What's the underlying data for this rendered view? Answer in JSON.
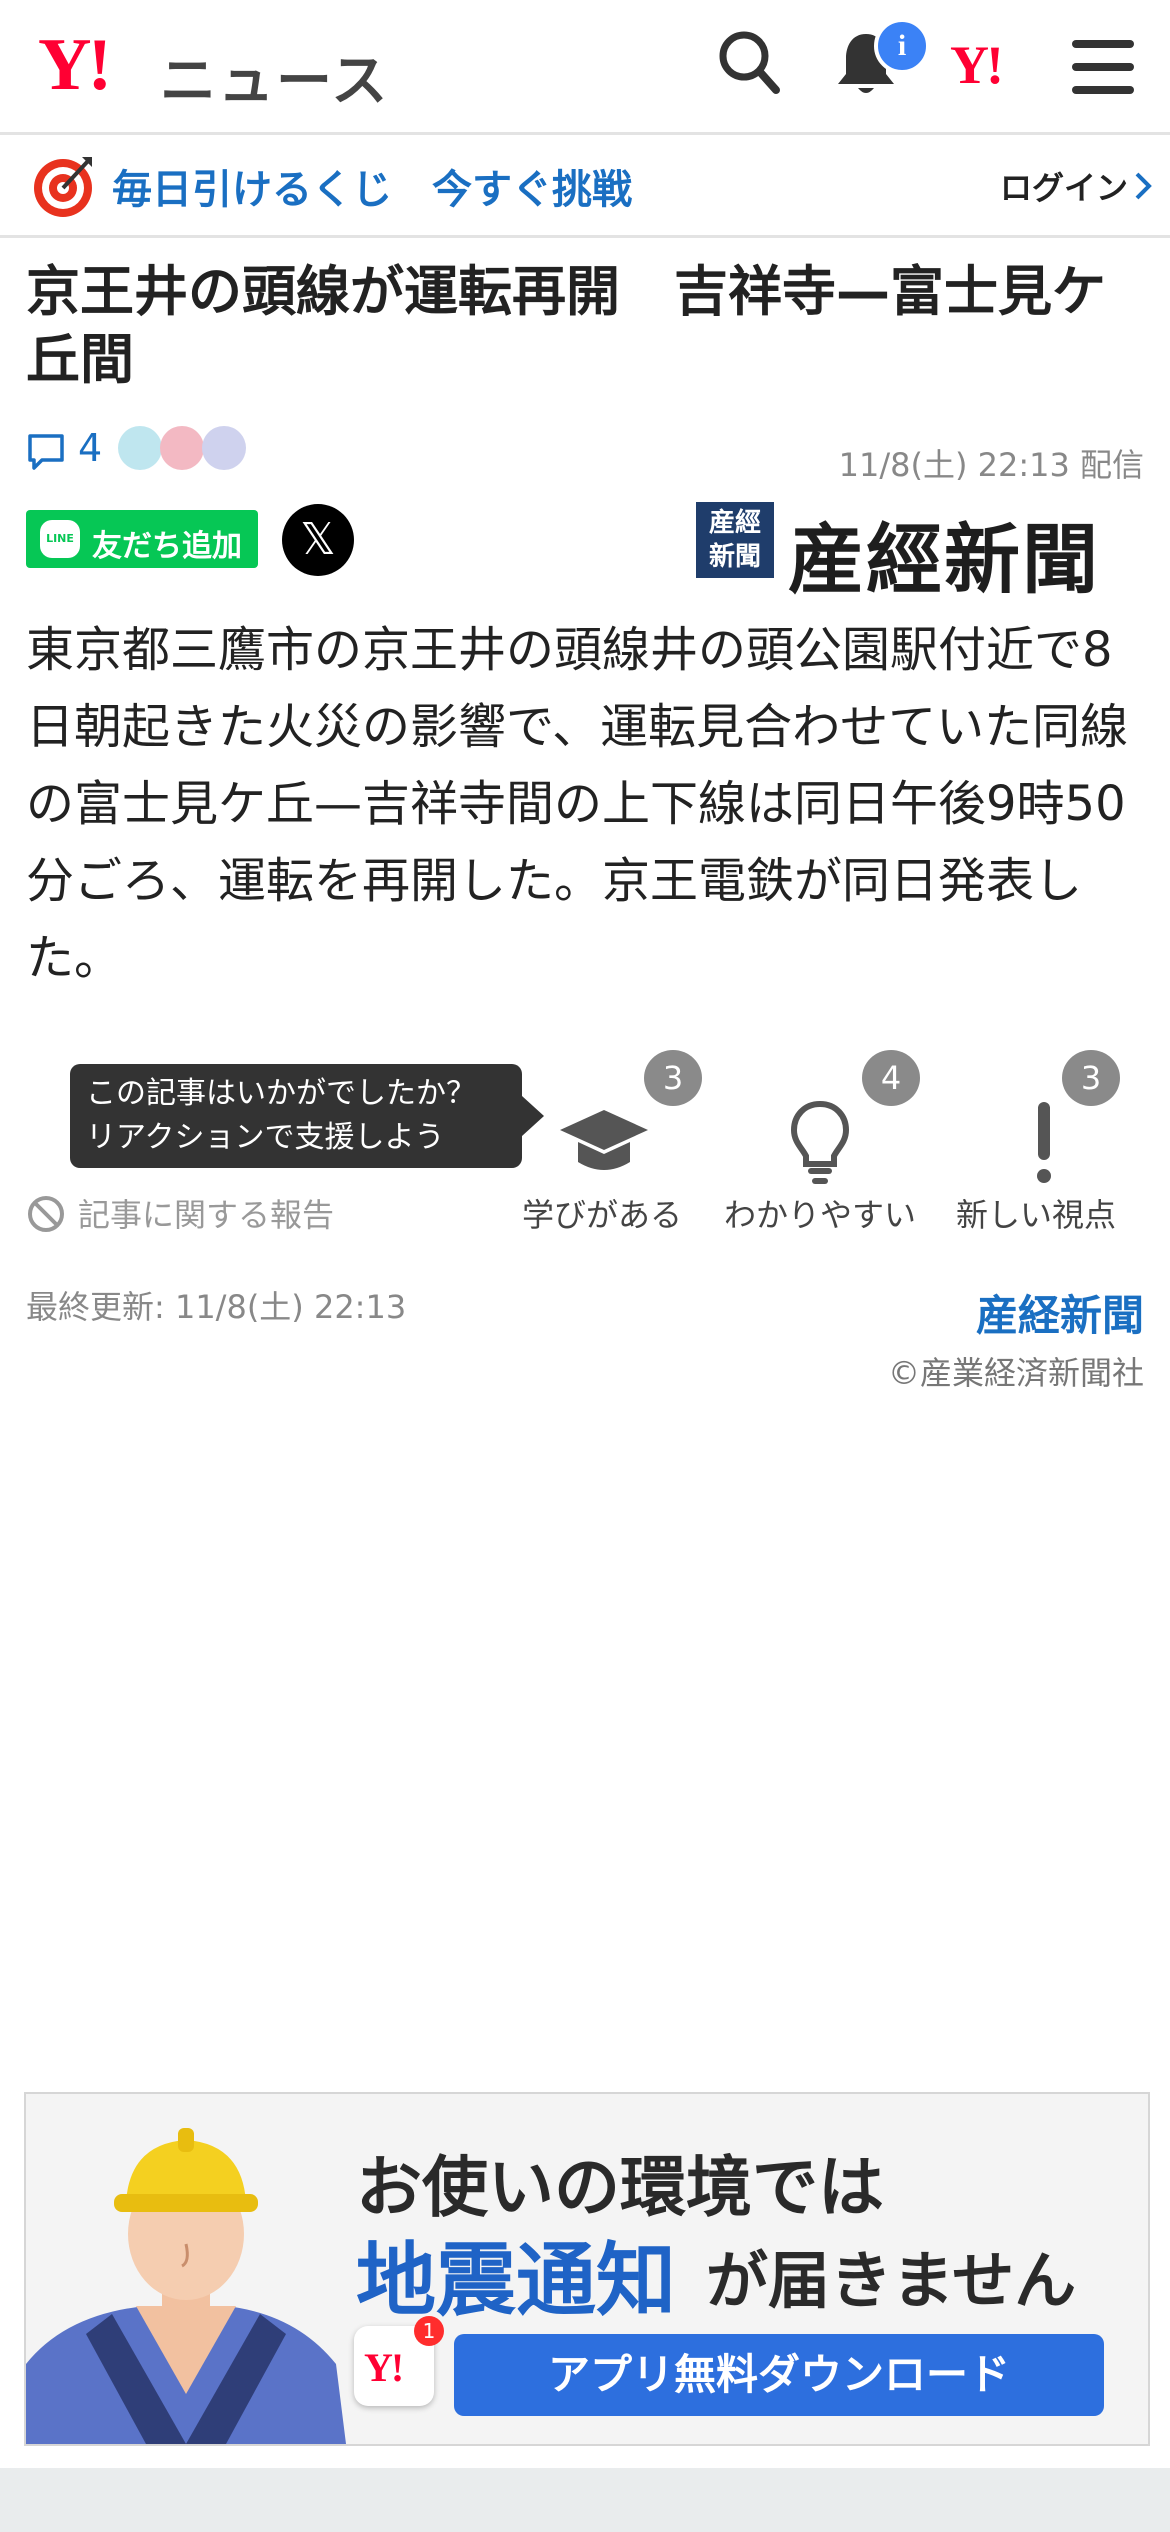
{
  "header": {
    "logo_mark": "Y!",
    "logo_text": "ニュース",
    "notification_badge": "i",
    "yahoo_mark": "Y!"
  },
  "promo": {
    "text": "毎日引けるくじ　今すぐ挑戦",
    "login": "ログイン"
  },
  "article": {
    "title": "京王井の頭線が運転再開　吉祥寺—富士見ケ丘間",
    "comment_count": "4",
    "date": "11/8(土) 22:13 配信",
    "line_button": "友だち追加",
    "line_tag": "LINE",
    "x_button": "𝕏",
    "source_mark": "産經新聞",
    "source_name": "産經新聞",
    "body": "東京都三鷹市の京王井の頭線井の頭公園駅付近で8日朝起きた火災の影響で、運転見合わせていた同線の富士見ケ丘—吉祥寺間の上下線は同日午後9時50分ごろ、運転を再開した。京王電鉄が同日発表した。"
  },
  "reactions": {
    "tooltip_line1": "この記事はいかがでしたか？",
    "tooltip_line2": "リアクションで支援しよう",
    "report": "記事に関する報告",
    "items": [
      {
        "label": "学びがある",
        "count": "3"
      },
      {
        "label": "わかりやすい",
        "count": "4"
      },
      {
        "label": "新しい視点",
        "count": "3"
      }
    ]
  },
  "footer": {
    "updated": "最終更新: 11/8(土) 22:13",
    "source": "産経新聞",
    "copyright": "©産業経済新聞社"
  },
  "banner": {
    "line1": "お使いの環境では",
    "line2": "地震通知",
    "line3": "が届きません",
    "button": "アプリ無料ダウンロード",
    "app_mark": "Y!",
    "app_badge": "1"
  },
  "colors": {
    "brand_red": "#ff0033",
    "link_blue": "#1a6fc2",
    "line_green": "#06c755",
    "button_blue": "#2d6fde"
  }
}
